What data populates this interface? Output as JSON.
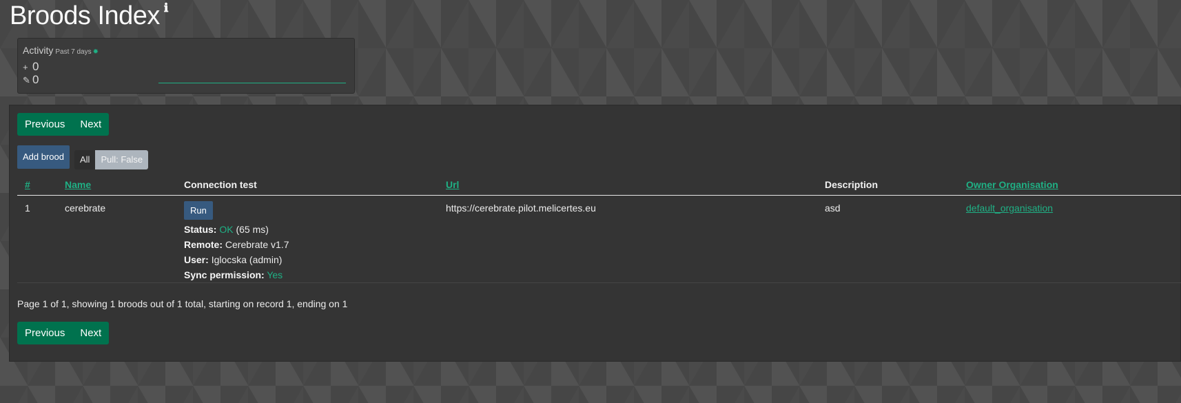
{
  "page": {
    "title": "Broods Index",
    "info_icon": "ℹ"
  },
  "activity": {
    "label": "Activity",
    "period": "Past 7 days",
    "icons": {
      "settings": "gear-icon",
      "added": "plus-icon",
      "edited": "edit-icon"
    },
    "added_count": "0",
    "edited_count": "0",
    "accent_color": "#1fb185"
  },
  "pagination": {
    "previous_label": "Previous",
    "next_label": "Next"
  },
  "toolbar": {
    "add_label": "Add brood",
    "filter_all": "All",
    "filter_pull": "Pull: False"
  },
  "table": {
    "columns": {
      "id": "#",
      "name": "Name",
      "connection": "Connection test",
      "url": "Url",
      "description": "Description",
      "owner": "Owner Organisation"
    },
    "rows": [
      {
        "id": "1",
        "name": "cerebrate",
        "run_label": "Run",
        "status_label": "Status:",
        "status_value": "OK",
        "status_time": "(65 ms)",
        "remote_label": "Remote:",
        "remote_value": "Cerebrate v1.7",
        "user_label": "User:",
        "user_value": "Iglocska (admin)",
        "sync_label": "Sync permission:",
        "sync_value": "Yes",
        "url": "https://cerebrate.pilot.melicertes.eu",
        "description": "asd",
        "owner": "default_organisation"
      }
    ]
  },
  "summary": "Page 1 of 1, showing 1 broods out of 1 total, starting on record 1, ending on 1",
  "colors": {
    "primary_green": "#00724e",
    "button_blue": "#375a7f",
    "link_green": "#1fb185",
    "panel": "#343434"
  }
}
